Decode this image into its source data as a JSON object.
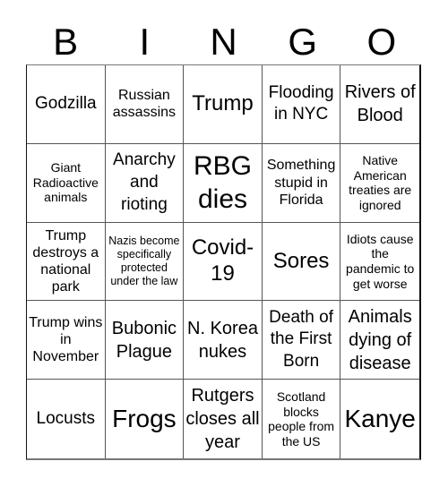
{
  "header": {
    "letters": [
      "B",
      "I",
      "N",
      "G",
      "O"
    ]
  },
  "cells": [
    "Godzilla",
    "Russian assassins",
    "Trump",
    "Flooding in NYC",
    "Rivers of Blood",
    "Giant Radioactive animals",
    "Anarchy and rioting",
    "RBG dies",
    "Something stupid in Florida",
    "Native American treaties are ignored",
    "Trump destroys a national park",
    "Nazis become specifically protected under the law",
    "Covid-19",
    "Sores",
    "Idiots cause the pandemic to get worse",
    "Trump wins in November",
    "Bubonic Plague",
    "N. Korea nukes",
    "Death of the First Born",
    "Animals dying of disease",
    "Locusts",
    "Frogs",
    "Rutgers closes all year",
    "Scotland blocks people from the US",
    "Kanye"
  ]
}
